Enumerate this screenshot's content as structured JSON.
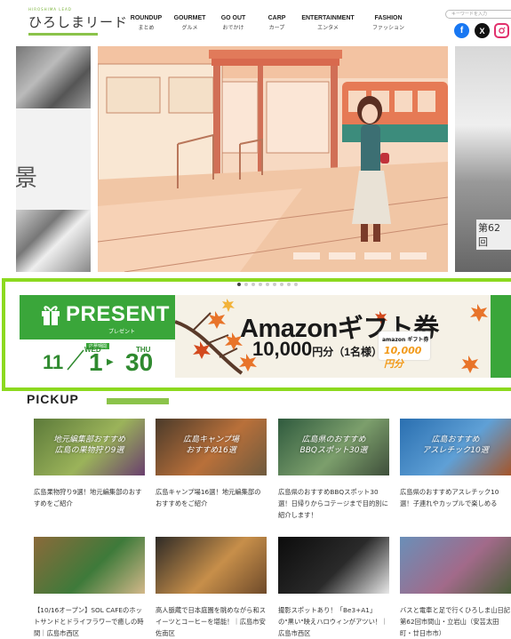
{
  "header": {
    "logo_text": "ひろしまリード",
    "logo_tagline": "HIROSHIMA LEAD",
    "nav": [
      {
        "en": "ROUNDUP",
        "jp": "まとめ"
      },
      {
        "en": "GOURMET",
        "jp": "グルメ"
      },
      {
        "en": "GO OUT",
        "jp": "おでかけ"
      },
      {
        "en": "CARP",
        "jp": "カープ"
      },
      {
        "en": "ENTERTAINMENT",
        "jp": "エンタメ"
      },
      {
        "en": "FASHION",
        "jp": "ファッション"
      }
    ],
    "search_placeholder": "キーワードを入力",
    "social": {
      "facebook": "f",
      "x": "X",
      "instagram": "◎"
    }
  },
  "hero": {
    "left_kanji": "景",
    "right_caption": "第62回"
  },
  "carousel": {
    "total": 9,
    "active": 0
  },
  "banner": {
    "present": "PRESENT",
    "present_sub": "プレゼント",
    "date_header": "応募期間",
    "month": "11",
    "start_dow": "WED",
    "start_day": "1",
    "arrow": "▶",
    "end_dow": "THU",
    "end_day": "30",
    "title": "Amazonギフト券",
    "amount": "10,000",
    "amount_suffix": "円分（1名様）",
    "card_brand": "amazon ギフト券",
    "card_value": "10,000円分"
  },
  "pickup": {
    "heading": "PICKUP",
    "cards": [
      {
        "title": "広島果物狩り9選！地元編集部のおすすめをご紹介",
        "overlay": "地元編集部おすすめ\n広島の果物狩り9選",
        "colors": [
          "#5c7a3a",
          "#9bb35a",
          "#6a3f6e"
        ]
      },
      {
        "title": "広島キャンプ場16選！地元編集部のおすすめをご紹介",
        "overlay": "広島キャンプ場\nおすすめ16選",
        "colors": [
          "#4a3a2a",
          "#b9703a",
          "#6e5a3e"
        ]
      },
      {
        "title": "広島県のおすすめBBQスポット30選！日帰りからコテージまで目的別に紹介します！",
        "overlay": "広島県のおすすめ\nBBQスポット30選",
        "colors": [
          "#2f5a3e",
          "#7c9f6c",
          "#3e4e3a"
        ]
      },
      {
        "title": "広島県のおすすめアスレチック10選！子連れやカップルで楽しめる",
        "overlay": "広島おすすめ\nアスレチック10選",
        "colors": [
          "#2a6fb0",
          "#5fa0d6",
          "#a5552a"
        ]
      },
      {
        "title": "【10/16オープン】SOL CAFEのホットサンドとドライフラワーで癒しの時間｜広島市西区",
        "overlay": "",
        "colors": [
          "#8b6a3a",
          "#3e7a3a",
          "#d3b88a"
        ]
      },
      {
        "title": "高人脈蔵で日本庭園を眺めながら和スイーツとコーヒーを堪能！｜広島市安佐南区",
        "overlay": "",
        "colors": [
          "#2e2a26",
          "#c78f4a",
          "#6e4a2a"
        ]
      },
      {
        "title": "撮影スポットあり！「Be3+A1」の\"黒い\"映えハロウィンがアツい！｜広島市西区",
        "overlay": "",
        "colors": [
          "#0c0c0c",
          "#2a2a2a",
          "#e8e8e8"
        ]
      },
      {
        "title": "バスと電車と足で行くひろしま山日記第62回市間山・立岩山（安芸太田町・廿日市市）",
        "overlay": "",
        "colors": [
          "#6a8fb8",
          "#a26a8a",
          "#4a5e3a"
        ]
      }
    ]
  },
  "colors": {
    "accent_green": "#8cd91f",
    "present_green": "#3aa63a"
  }
}
